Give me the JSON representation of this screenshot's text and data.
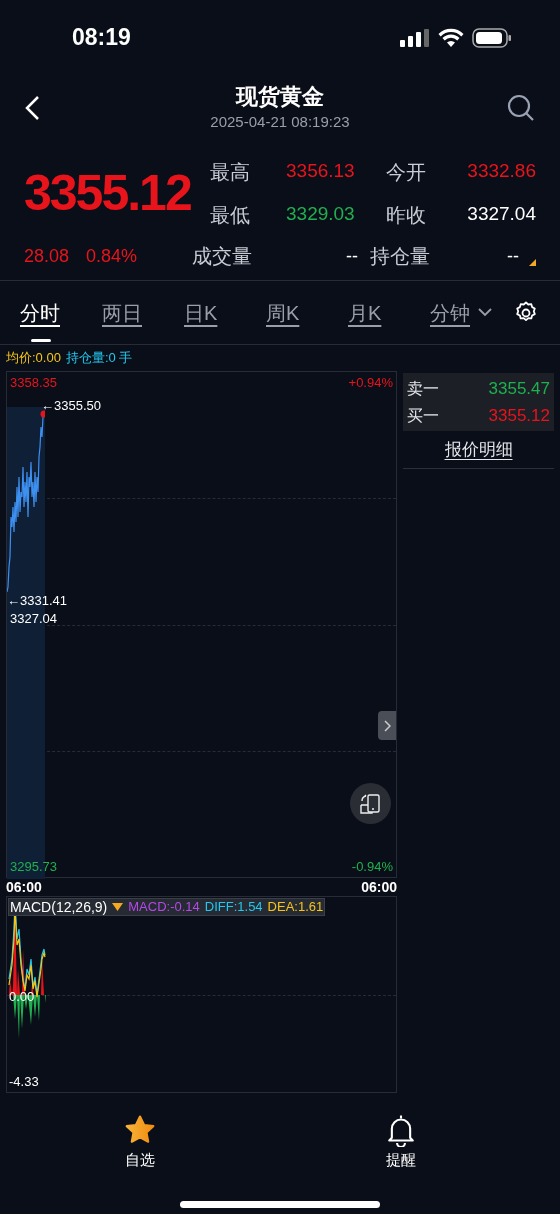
{
  "status_bar": {
    "time": "08:19"
  },
  "header": {
    "title": "现货黄金",
    "datetime": "2025-04-21 08:19:23"
  },
  "quote": {
    "price": "3355.12",
    "change": "28.08",
    "change_pct": "0.84%",
    "stats": [
      {
        "label": "最高",
        "value": "3356.13",
        "color": "#e8141c"
      },
      {
        "label": "今开",
        "value": "3332.86",
        "color": "#e8141c"
      },
      {
        "label": "最低",
        "value": "3329.03",
        "color": "#1fb04f"
      },
      {
        "label": "昨收",
        "value": "3327.04",
        "color": "#ffffff"
      }
    ],
    "volume": {
      "label": "成交量",
      "value": "--"
    },
    "open_interest": {
      "label": "持仓量",
      "value": "--"
    }
  },
  "tabs": [
    {
      "label": "分时",
      "selected": true,
      "kind": "tab"
    },
    {
      "label": "两日",
      "selected": false,
      "kind": "tab"
    },
    {
      "label": "日K",
      "selected": false,
      "kind": "tab"
    },
    {
      "label": "周K",
      "selected": false,
      "kind": "tab"
    },
    {
      "label": "月K",
      "selected": false,
      "kind": "tab"
    },
    {
      "label": "分钟",
      "selected": false,
      "kind": "dropdown"
    }
  ],
  "indicators": [
    {
      "text": "均价:0.00",
      "color": "#f5c518"
    },
    {
      "text": "持仓量:0 手",
      "color": "#22c8f0"
    }
  ],
  "chart": {
    "max_price": "3358.35",
    "max_pct": "+0.94%",
    "high_marker": "←3355.50",
    "low_marker": "←3331.41",
    "prev_close": "3327.04",
    "min_price": "3295.73",
    "min_pct": "-0.94%",
    "time_start": "06:00",
    "time_end": "06:00"
  },
  "order_book": [
    {
      "label": "卖一",
      "value": "3355.47",
      "color": "#1fb04f"
    },
    {
      "label": "买一",
      "value": "3355.12",
      "color": "#e8141c"
    }
  ],
  "detail_link": "报价明细",
  "macd": {
    "title": "MACD(12,26,9)",
    "values": [
      {
        "text": "MACD:-0.14",
        "color": "#b548e8"
      },
      {
        "text": "DIFF:1.54",
        "color": "#22c8f0"
      },
      {
        "text": "DEA:1.61",
        "color": "#f5c518"
      }
    ],
    "zero_label": "0.00",
    "min_label": "-4.33"
  },
  "nav": [
    {
      "label": "自选",
      "kind": "star"
    },
    {
      "label": "提醒",
      "kind": "bell"
    }
  ]
}
